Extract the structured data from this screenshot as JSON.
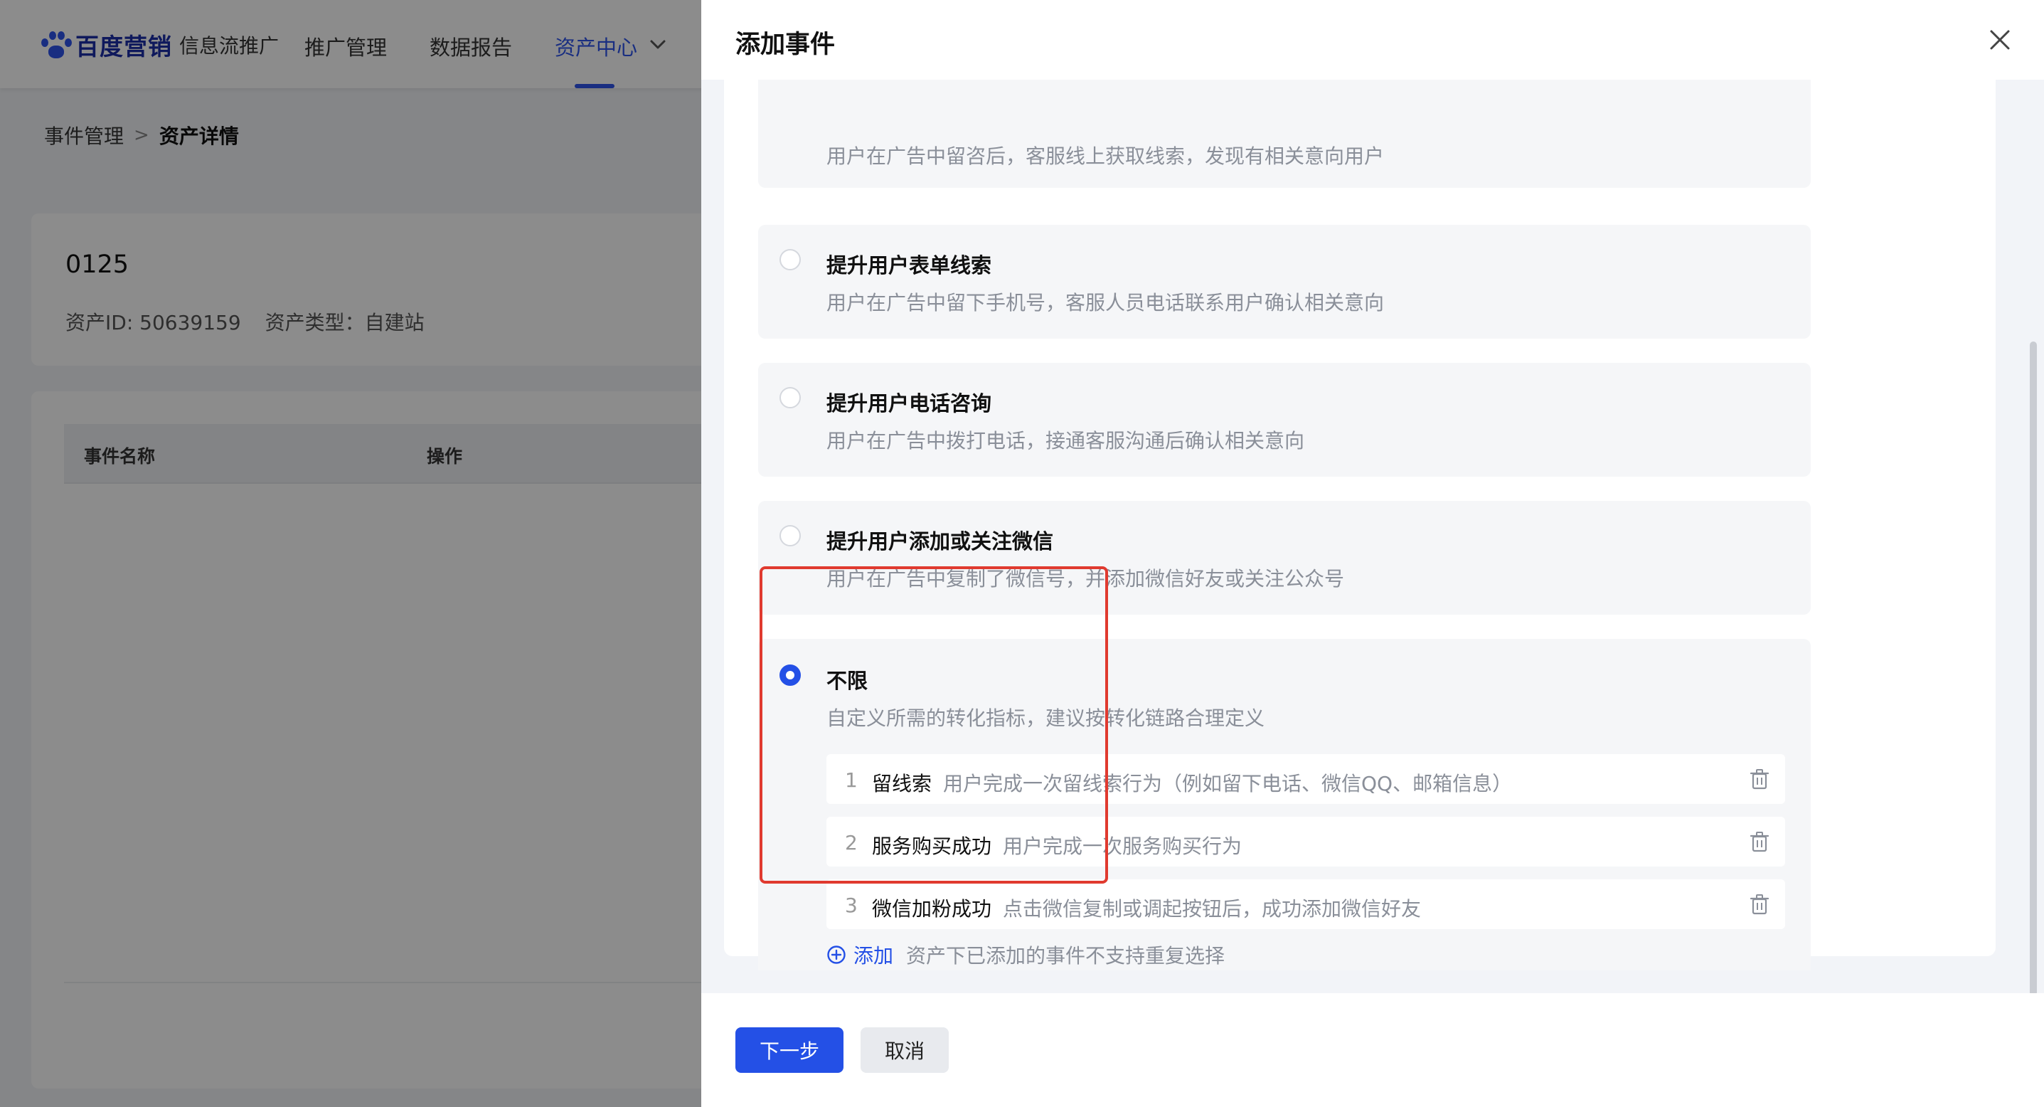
{
  "header": {
    "brand_name": "百度营销",
    "brand_sub": "信息流推广",
    "nav": [
      {
        "label": "推广管理",
        "active": false
      },
      {
        "label": "数据报告",
        "active": false
      },
      {
        "label": "资产中心",
        "active": true
      }
    ]
  },
  "breadcrumb": {
    "parent": "事件管理",
    "separator": ">",
    "current": "资产详情"
  },
  "asset": {
    "name": "0125",
    "id_text": "资产ID: 50639159",
    "type_text": "资产类型：自建站"
  },
  "table": {
    "columns": [
      "事件名称",
      "操作"
    ]
  },
  "drawer": {
    "title": "添加事件",
    "partial_desc": "用户在广告中留咨后，客服线上获取线索，发现有相关意向用户",
    "options": [
      {
        "title": "提升用户表单线索",
        "desc": "用户在广告中留下手机号，客服人员电话联系用户确认相关意向",
        "selected": false
      },
      {
        "title": "提升用户电话咨询",
        "desc": "用户在广告中拨打电话，接通客服沟通后确认相关意向",
        "selected": false
      },
      {
        "title": "提升用户添加或关注微信",
        "desc": "用户在广告中复制了微信号，并添加微信好友或关注公众号",
        "selected": false
      },
      {
        "title": "不限",
        "desc": "自定义所需的转化指标，建议按转化链路合理定义",
        "selected": true
      }
    ],
    "events": [
      {
        "num": "1",
        "name": "留线索",
        "desc": "用户完成一次留线索行为（例如留下电话、微信QQ、邮箱信息）"
      },
      {
        "num": "2",
        "name": "服务购买成功",
        "desc": "用户完成一次服务购买行为"
      },
      {
        "num": "3",
        "name": "微信加粉成功",
        "desc": "点击微信复制或调起按钮后，成功添加微信好友"
      }
    ],
    "add_label": "添加",
    "add_note": "资产下已添加的事件不支持重复选择",
    "next_label": "下一步",
    "cancel_label": "取消"
  },
  "colors": {
    "primary": "#2450e6",
    "highlight": "#e03a2f",
    "muted_text": "#8a8f99"
  }
}
